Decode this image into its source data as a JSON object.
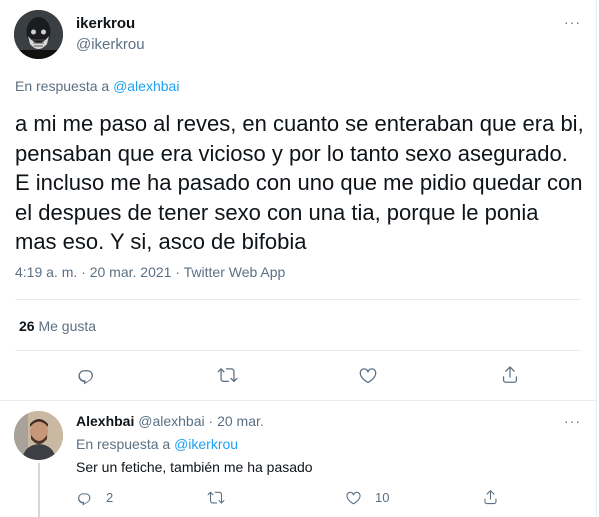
{
  "main_tweet": {
    "author_name": "ikerkrou",
    "author_handle": "@ikerkrou",
    "more": "···",
    "reply_prefix": "En respuesta a ",
    "reply_to": "@alexhbai",
    "text": "a mi me paso al reves, en cuanto se enteraban que era bi, pensaban que era vicioso y por lo tanto sexo asegurado. E incluso me ha pasado con uno que me pidio quedar con el despues de tener sexo con una tia, porque le ponia mas eso. Y si, asco de bifobia",
    "time": "4:19 a. m.",
    "sep": "·",
    "date": "20 mar. 2021",
    "source": "Twitter Web App",
    "likes_count": "26",
    "likes_label": "Me gusta"
  },
  "reply_tweet": {
    "author_name": "Alexhbai",
    "author_handle": "@alexhbai",
    "sep": "·",
    "date": "20 mar.",
    "more": "···",
    "reply_prefix": "En respuesta a ",
    "reply_to": "@ikerkrou",
    "text": "Ser un fetiche, también me ha pasado",
    "reply_count": "2",
    "like_count": "10"
  },
  "icons": {
    "reply": "reply-icon",
    "retweet": "retweet-icon",
    "like": "heart-icon",
    "share": "share-icon"
  },
  "colors": {
    "link": "#1da1f2",
    "secondary_text": "#5b7083",
    "divider": "#e6ecf0"
  }
}
